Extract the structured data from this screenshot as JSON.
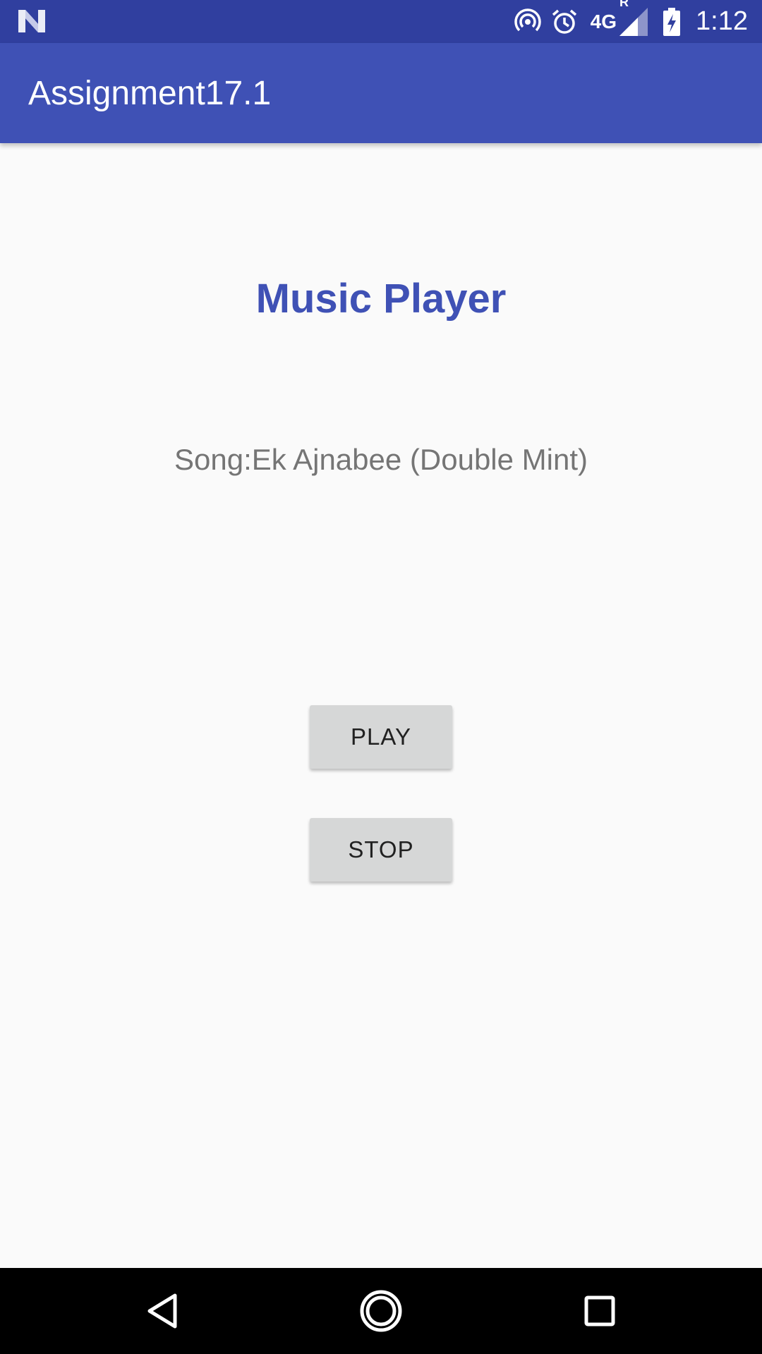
{
  "status_bar": {
    "time": "1:12",
    "network": "4G",
    "roaming": "R",
    "icons": [
      "n-logo-icon",
      "hotspot-icon",
      "alarm-icon",
      "signal-icon",
      "battery-charging-icon"
    ]
  },
  "app_bar": {
    "title": "Assignment17.1"
  },
  "main": {
    "heading": "Music Player",
    "song_label": "Song:Ek Ajnabee (Double Mint)",
    "play_label": "PLAY",
    "stop_label": "STOP"
  },
  "nav_bar": {
    "icons": [
      "back-icon",
      "home-icon",
      "recents-icon"
    ]
  },
  "colors": {
    "status_bar": "#303f9f",
    "app_bar": "#3f51b5",
    "heading": "#3f51b5",
    "song_text": "#757575",
    "button_bg": "#d6d7d7",
    "background": "#fafafa"
  }
}
